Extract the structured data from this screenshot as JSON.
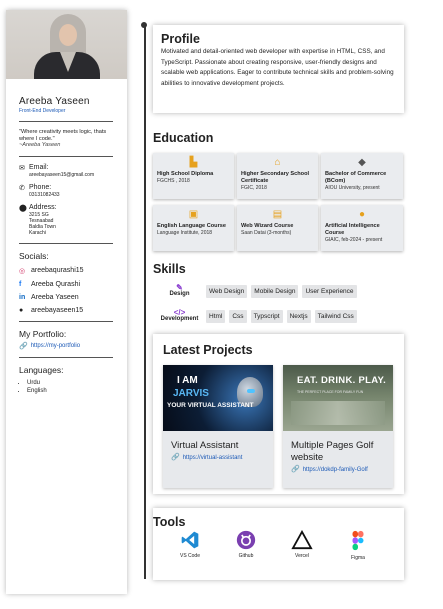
{
  "sidebar": {
    "name": "Areeba Yaseen",
    "role": "Front-End Developer",
    "quote": "\"Where creativity meets logic, thats where I code.\"",
    "quote_author": "~Areeba Yaseen",
    "contact": {
      "email_label": "Email:",
      "email_value": "areebayaseen15@gmail.com",
      "phone_label": "Phone:",
      "phone_value": "03131082433",
      "address_label": "Address:",
      "address_lines": [
        "3215 SG",
        "Tesnaabad",
        "Baldia Town",
        "Karachi"
      ]
    },
    "socials_label": "Socials:",
    "socials": [
      {
        "icon": "instagram-icon",
        "label": "areebaqurashi15"
      },
      {
        "icon": "facebook-icon",
        "label": "Areeba Qurashi"
      },
      {
        "icon": "linkedin-icon",
        "label": "Areeba Yaseen"
      },
      {
        "icon": "github-icon",
        "label": "areebayaseen15"
      }
    ],
    "portfolio_label": "My Portfolio:",
    "portfolio_link": "https://my-portfolio",
    "languages_label": "Languages:",
    "languages": [
      "Urdu",
      "English"
    ]
  },
  "profile": {
    "title": "Profile",
    "text": "Motivated and detail-oriented web developer with expertise in HTML, CSS, and TypeScript. Passionate about creating responsive, user-friendly designs and scalable web applications. Eager to contribute technical skills and problem-solving abilities to innovative development projects."
  },
  "education": {
    "title": "Education",
    "items": [
      {
        "icon": "school-icon",
        "title": "High School Diploma",
        "sub": "FGCHS , 2018"
      },
      {
        "icon": "university-icon",
        "title": "Higher Secondary School Certificate",
        "sub": "FGIC, 2018"
      },
      {
        "icon": "graduation-cap-icon",
        "title": "Bachelor of Commerce (BCom)",
        "sub": "AIOU University, present"
      },
      {
        "icon": "language-icon",
        "title": "English Language Course",
        "sub": "Language Institute, 2018"
      },
      {
        "icon": "certificate-icon",
        "title": "Web Wizard Course",
        "sub": "Saan Datai (3-months)"
      },
      {
        "icon": "brain-icon",
        "title": "Artificial Intelligence Course",
        "sub": "GIAIC, feb-2024 - present"
      }
    ]
  },
  "skills": {
    "title": "Skills",
    "design_label": "Design",
    "design": [
      "Web Design",
      "Mobile Design",
      "User Experience"
    ],
    "development_label": "Development",
    "development": [
      "Html",
      "Css",
      "Typscript",
      "Nextjs",
      "Tailwind Css"
    ]
  },
  "projects": {
    "title": "Latest Projects",
    "items": [
      {
        "thumb_line1": "I AM",
        "thumb_line2": "JARVIS",
        "thumb_line3": "YOUR VIRTUAL ASSISTANT",
        "title": "Virtual Assistant",
        "link": "https://virtual-assistant"
      },
      {
        "thumb_line1": "EAT. DRINK. PLAY.",
        "thumb_line2": "THE PERFECT PLACE FOR FAMILY FUN",
        "title": "Multiple Pages Golf website",
        "link": "https://dokdp-family-Golf"
      }
    ]
  },
  "tools": {
    "title": "Tools",
    "items": [
      {
        "icon": "vscode-icon",
        "label": "VS Code"
      },
      {
        "icon": "github-icon",
        "label": "Github"
      },
      {
        "icon": "vercel-icon",
        "label": "Vercel"
      },
      {
        "icon": "figma-icon",
        "label": "Figma"
      }
    ]
  }
}
